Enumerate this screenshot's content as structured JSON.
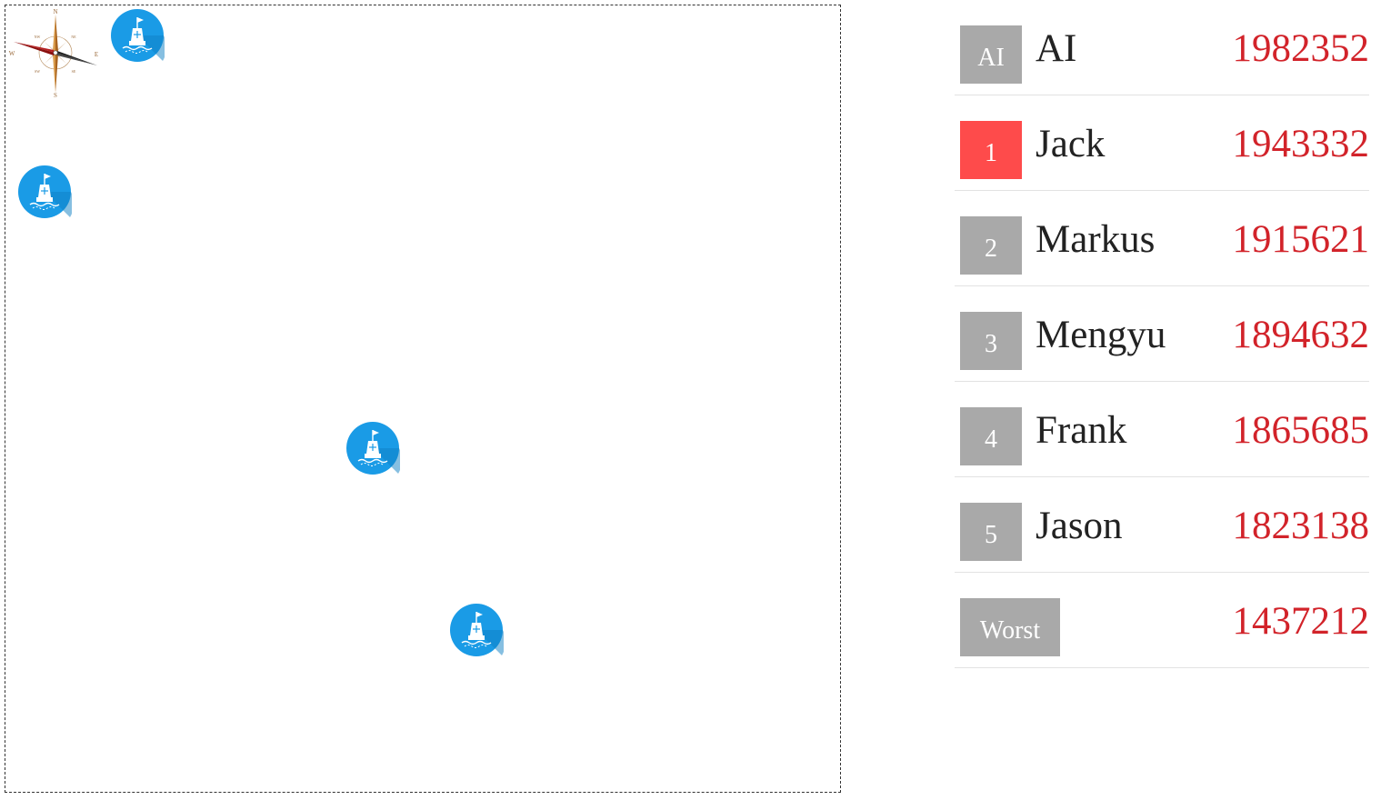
{
  "map": {
    "compass": {
      "north": "N",
      "south": "S",
      "east": "E",
      "west": "W",
      "northwest": "NW",
      "northeast": "NE",
      "southwest": "SW",
      "southeast": "SE"
    },
    "buoys": [
      {
        "icon": "buoy-icon"
      },
      {
        "icon": "buoy-icon"
      },
      {
        "icon": "buoy-icon"
      },
      {
        "icon": "buoy-icon"
      }
    ]
  },
  "leaderboard": {
    "rows": [
      {
        "rank": "AI",
        "name": "AI",
        "score": "1982352",
        "highlight": false
      },
      {
        "rank": "1",
        "name": "Jack",
        "score": "1943332",
        "highlight": true
      },
      {
        "rank": "2",
        "name": "Markus",
        "score": "1915621",
        "highlight": false
      },
      {
        "rank": "3",
        "name": "Mengyu",
        "score": "1894632",
        "highlight": false
      },
      {
        "rank": "4",
        "name": "Frank",
        "score": "1865685",
        "highlight": false
      },
      {
        "rank": "5",
        "name": "Jason",
        "score": "1823138",
        "highlight": false
      },
      {
        "rank": "Worst",
        "name": "",
        "score": "1437212",
        "highlight": false
      }
    ]
  },
  "colors": {
    "badge_default": "#a9a9a9",
    "badge_highlight": "#fe4b4b",
    "score": "#d2232a",
    "buoy": "#1a9be6"
  }
}
